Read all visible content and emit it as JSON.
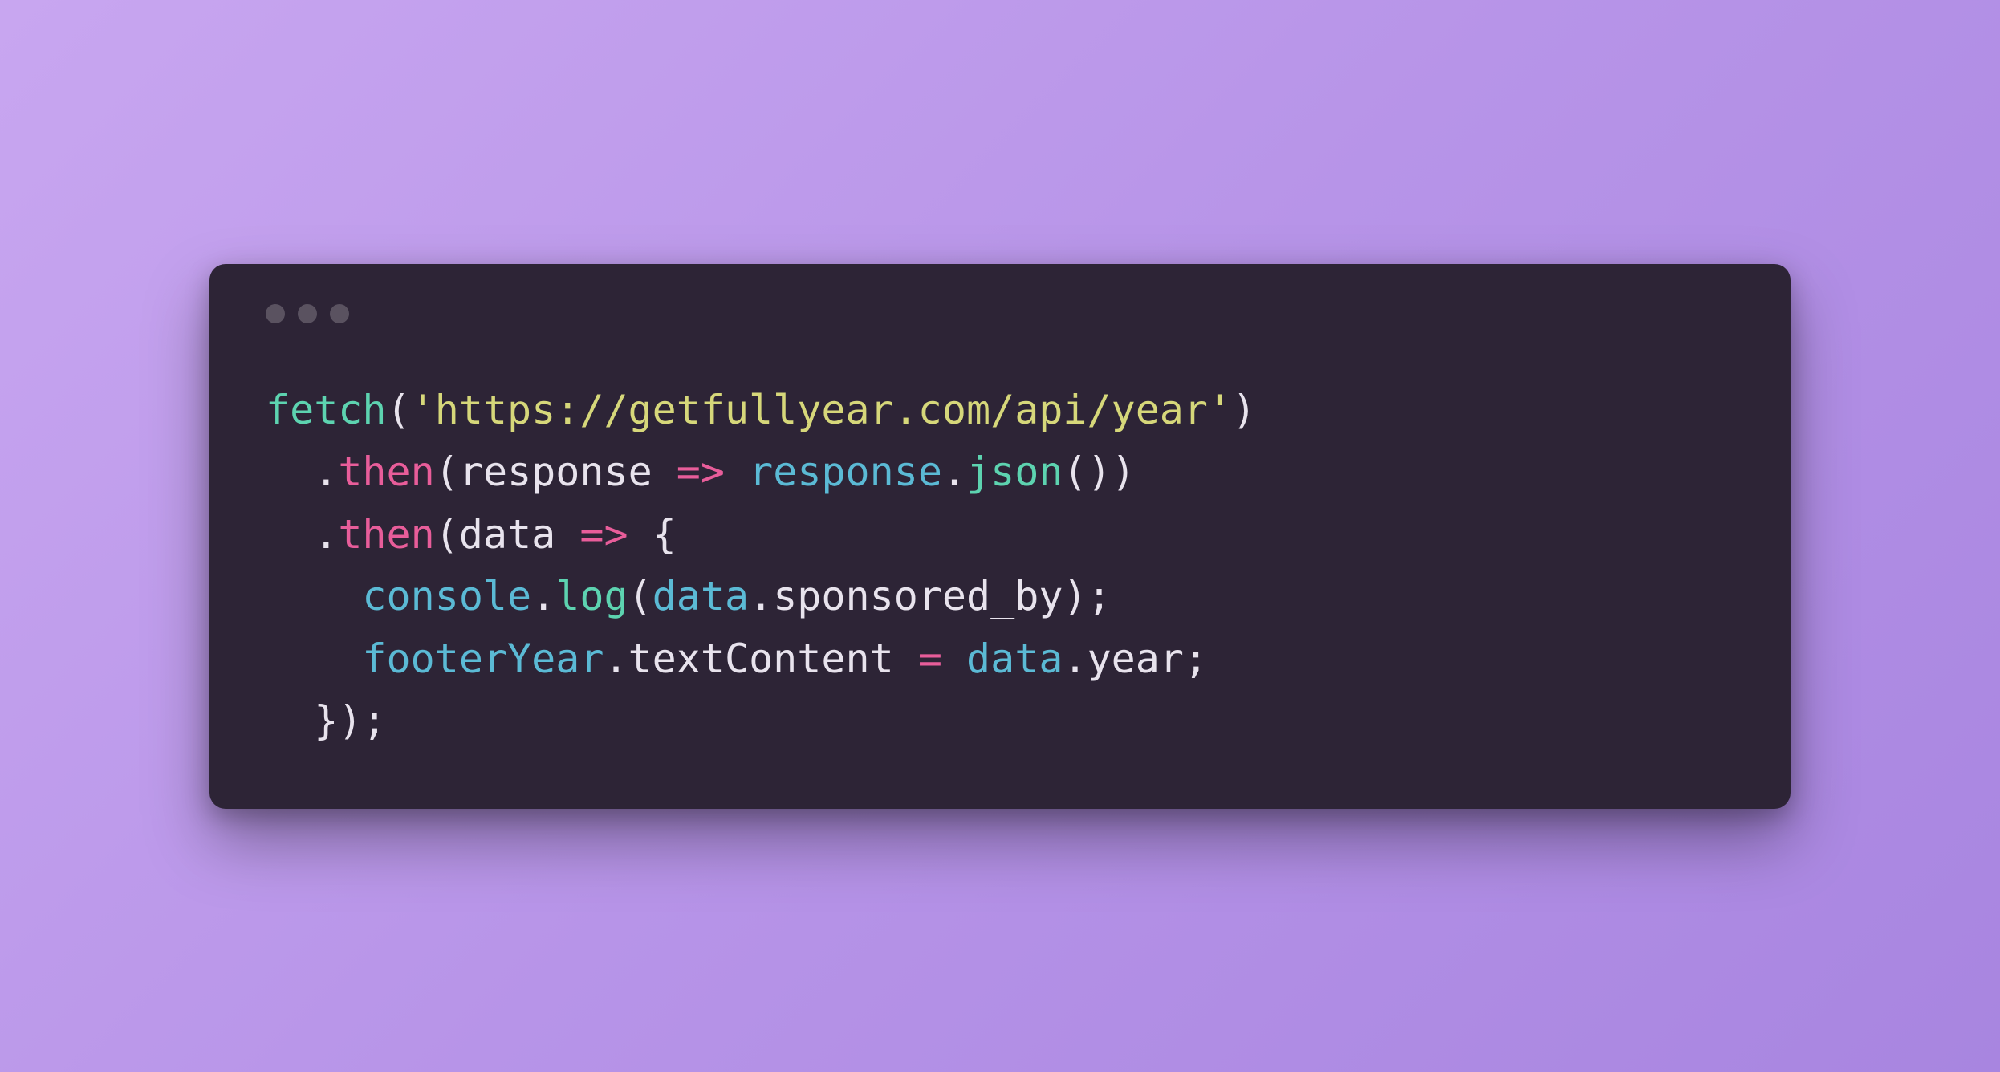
{
  "code": {
    "tokens": {
      "fetch": "fetch",
      "paren_open": "(",
      "paren_close": ")",
      "url_string": "'https://getfullyear.com/api/year'",
      "dot": ".",
      "then": "then",
      "response": "response",
      "arrow": "=>",
      "json": "json",
      "data": "data",
      "brace_open": "{",
      "brace_close": "}",
      "console": "console",
      "log": "log",
      "sponsored_by": "sponsored_by",
      "footerYear": "footerYear",
      "textContent": "textContent",
      "equals": "=",
      "year": "year",
      "semicolon": ";",
      "indent1": "  ",
      "indent2": "    "
    }
  },
  "colors": {
    "window_bg": "#2d2436",
    "text_default": "#e8e3ed",
    "fn_green": "#5dd3b0",
    "string_yellow": "#d6d77a",
    "method_pink": "#e85d9a",
    "obj_cyan": "#5bbad5",
    "traffic_light": "#5a5260",
    "bg_gradient_start": "#c8a6f0",
    "bg_gradient_end": "#a885e0"
  }
}
